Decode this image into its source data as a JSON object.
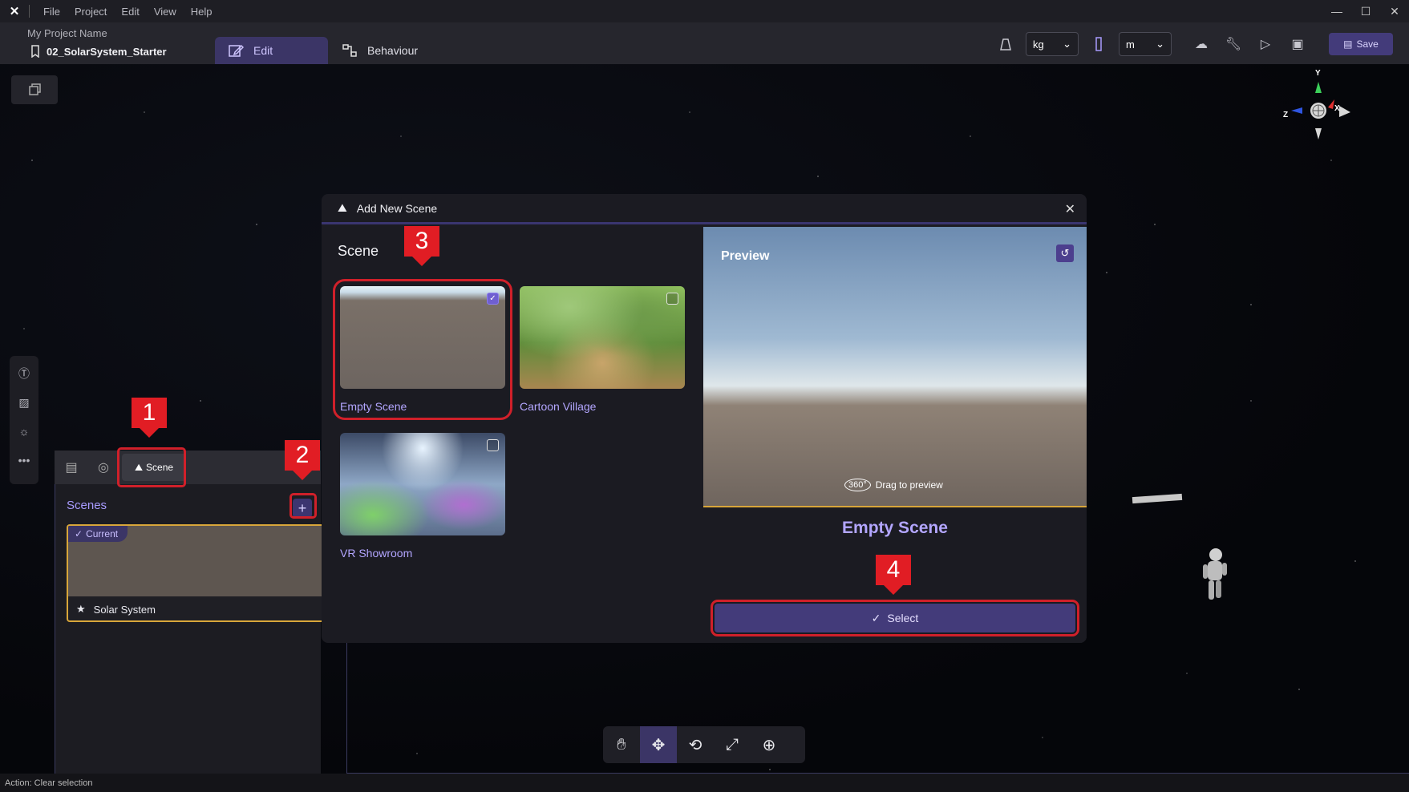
{
  "menu": {
    "items": [
      "File",
      "Project",
      "Edit",
      "View",
      "Help"
    ]
  },
  "header": {
    "project_name": "My Project Name",
    "file_name": "02_SolarSystem_Starter",
    "tabs": {
      "edit": "Edit",
      "behaviour": "Behaviour"
    },
    "mass_unit": "kg",
    "length_unit": "m",
    "save_label": "Save"
  },
  "panel": {
    "scene_tab_label": "Scene",
    "scenes_title": "Scenes",
    "current_badge": "Current",
    "scene_name": "Solar System"
  },
  "modal": {
    "title": "Add New Scene",
    "section": "Scene",
    "tiles": [
      {
        "label": "Empty Scene",
        "checked": true
      },
      {
        "label": "Cartoon Village",
        "checked": false
      },
      {
        "label": "VR Showroom",
        "checked": false
      }
    ],
    "preview_label": "Preview",
    "degrees_badge": "360°",
    "drag_hint": "Drag to preview",
    "selected_title": "Empty Scene",
    "select_label": "Select"
  },
  "callouts": [
    "1",
    "2",
    "3",
    "4"
  ],
  "gizmo": {
    "y": "Y",
    "z": "Z",
    "x": "X"
  },
  "status": "Action: Clear selection",
  "colors": {
    "accent": "#433b7a",
    "accent_text": "#b3a6ff",
    "highlight": "#d0202a",
    "callout": "#e11d24",
    "current_border": "#d8a63a"
  }
}
